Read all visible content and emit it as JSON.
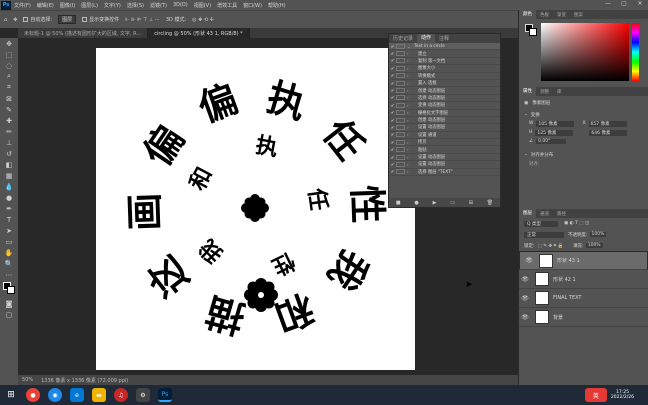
{
  "app": {
    "logo_text": "Ps"
  },
  "menus": [
    "文件(F)",
    "编辑(E)",
    "图像(I)",
    "图层(L)",
    "文字(Y)",
    "选择(S)",
    "滤镜(T)",
    "3D(D)",
    "视图(V)",
    "增效工具",
    "窗口(W)",
    "帮助(H)"
  ],
  "window_controls": [
    "—",
    "▢",
    "✕"
  ],
  "options": {
    "auto_select_label": "自动选择:",
    "auto_select_value": "图层",
    "transform_label": "显示变换控件",
    "mode_label": "3D 模式:"
  },
  "tabs": [
    {
      "label": "未标题-1 @ 50% (描述有圆形扩大的区域, 文字, R...",
      "active": false
    },
    {
      "label": "circling @ 50% (形状 43 1, RGB/8) *",
      "active": true
    }
  ],
  "status": {
    "zoom": "50%",
    "info": "1336 像素 x 1336 像素 (72.009 ppi)"
  },
  "canvas_text": {
    "ring_outer": [
      "偏",
      "执",
      "任",
      "性",
      "我",
      "和",
      "描",
      "这",
      "画",
      "偏"
    ],
    "ring_inner": [
      "执",
      "任",
      "性",
      "我",
      "和"
    ]
  },
  "history": {
    "tabs": [
      "历史记录",
      "动作",
      "注释"
    ],
    "rows": [
      {
        "check": "✔",
        "label": "Text in a circle",
        "root": true
      },
      {
        "check": "✔",
        "label": "建立"
      },
      {
        "check": "✔",
        "label": "复制 第一文档"
      },
      {
        "check": "✔",
        "label": "图像大小"
      },
      {
        "check": "✔",
        "label": "转换模式"
      },
      {
        "check": "✔",
        "label": "置入 选框"
      },
      {
        "check": "✔",
        "label": "创建 动态图层"
      },
      {
        "check": "✔",
        "label": "选择 动态图层"
      },
      {
        "check": "✔",
        "label": "变换 动态图层"
      },
      {
        "check": "✔",
        "label": "栅格化文字图层"
      },
      {
        "check": "✔",
        "label": "创建 动态图层"
      },
      {
        "check": "✔",
        "label": "设置 动态图层"
      },
      {
        "check": "✔",
        "label": "设置 通道"
      },
      {
        "check": "✔",
        "label": "拷贝"
      },
      {
        "check": "✔",
        "label": "粘贴"
      },
      {
        "check": "✔",
        "label": "设置 动态图层"
      },
      {
        "check": "✔",
        "label": "设置 动态图层"
      },
      {
        "check": "✔",
        "label": "选择 图层 \"TEXT\""
      }
    ]
  },
  "right_panel": {
    "top_tabs": [
      "颜色",
      "色板",
      "渐变",
      "图案"
    ],
    "props_tabs": [
      "属性",
      "调整",
      "库"
    ],
    "props_layer": "像素图层",
    "transform_label": "变换",
    "w_label": "W",
    "w_value": "105 像素",
    "x_label": "X",
    "x_value": "657 像素",
    "h_label": "H",
    "h_value": "125 像素",
    "y_value": "646 像素",
    "angle": "0.00°",
    "align_label": "对齐并分布",
    "align_sub": "对齐:",
    "layers_tabs": [
      "图层",
      "通道",
      "路径"
    ],
    "kind_label": "Q 类型",
    "blend_mode": "正常",
    "opacity_label": "不透明度:",
    "opacity_value": "100%",
    "lock_label": "锁定:",
    "fill_label": "填充:",
    "fill_value": "100%",
    "layers": [
      {
        "name": "形状 43 1",
        "selected": true
      },
      {
        "name": "形状 42 1",
        "selected": false
      },
      {
        "name": "FINAL TEXT",
        "selected": false
      },
      {
        "name": "背景",
        "selected": false
      }
    ]
  },
  "taskbar": {
    "time": "17:25",
    "date": "2022/2/26",
    "ime": "英"
  },
  "colors": {
    "accent": "#31a8ff",
    "taskbar": "#1f2937"
  }
}
